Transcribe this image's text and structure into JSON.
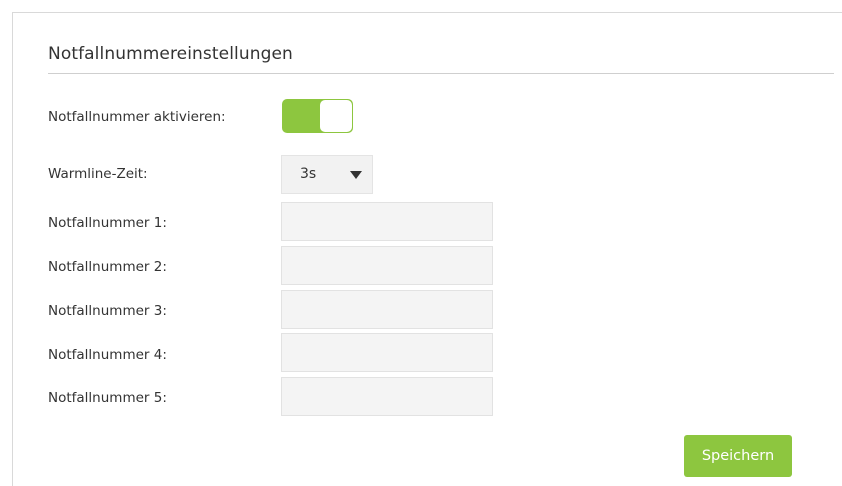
{
  "section": {
    "title": "Notfallnummereinstellungen"
  },
  "form": {
    "enable": {
      "label": "Notfallnummer aktivieren:",
      "state": "on"
    },
    "warmline": {
      "label": "Warmline-Zeit:",
      "value": "3s"
    },
    "numbers": [
      {
        "label": "Notfallnummer 1:",
        "value": ""
      },
      {
        "label": "Notfallnummer 2:",
        "value": ""
      },
      {
        "label": "Notfallnummer 3:",
        "value": ""
      },
      {
        "label": "Notfallnummer 4:",
        "value": ""
      },
      {
        "label": "Notfallnummer 5:",
        "value": ""
      }
    ]
  },
  "actions": {
    "save_label": "Speichern"
  },
  "colors": {
    "accent": "#8dc63f",
    "input_bg": "#f4f4f4",
    "rule": "#cfcfcf"
  },
  "icons": {
    "dropdown": "chevron-down-icon"
  }
}
